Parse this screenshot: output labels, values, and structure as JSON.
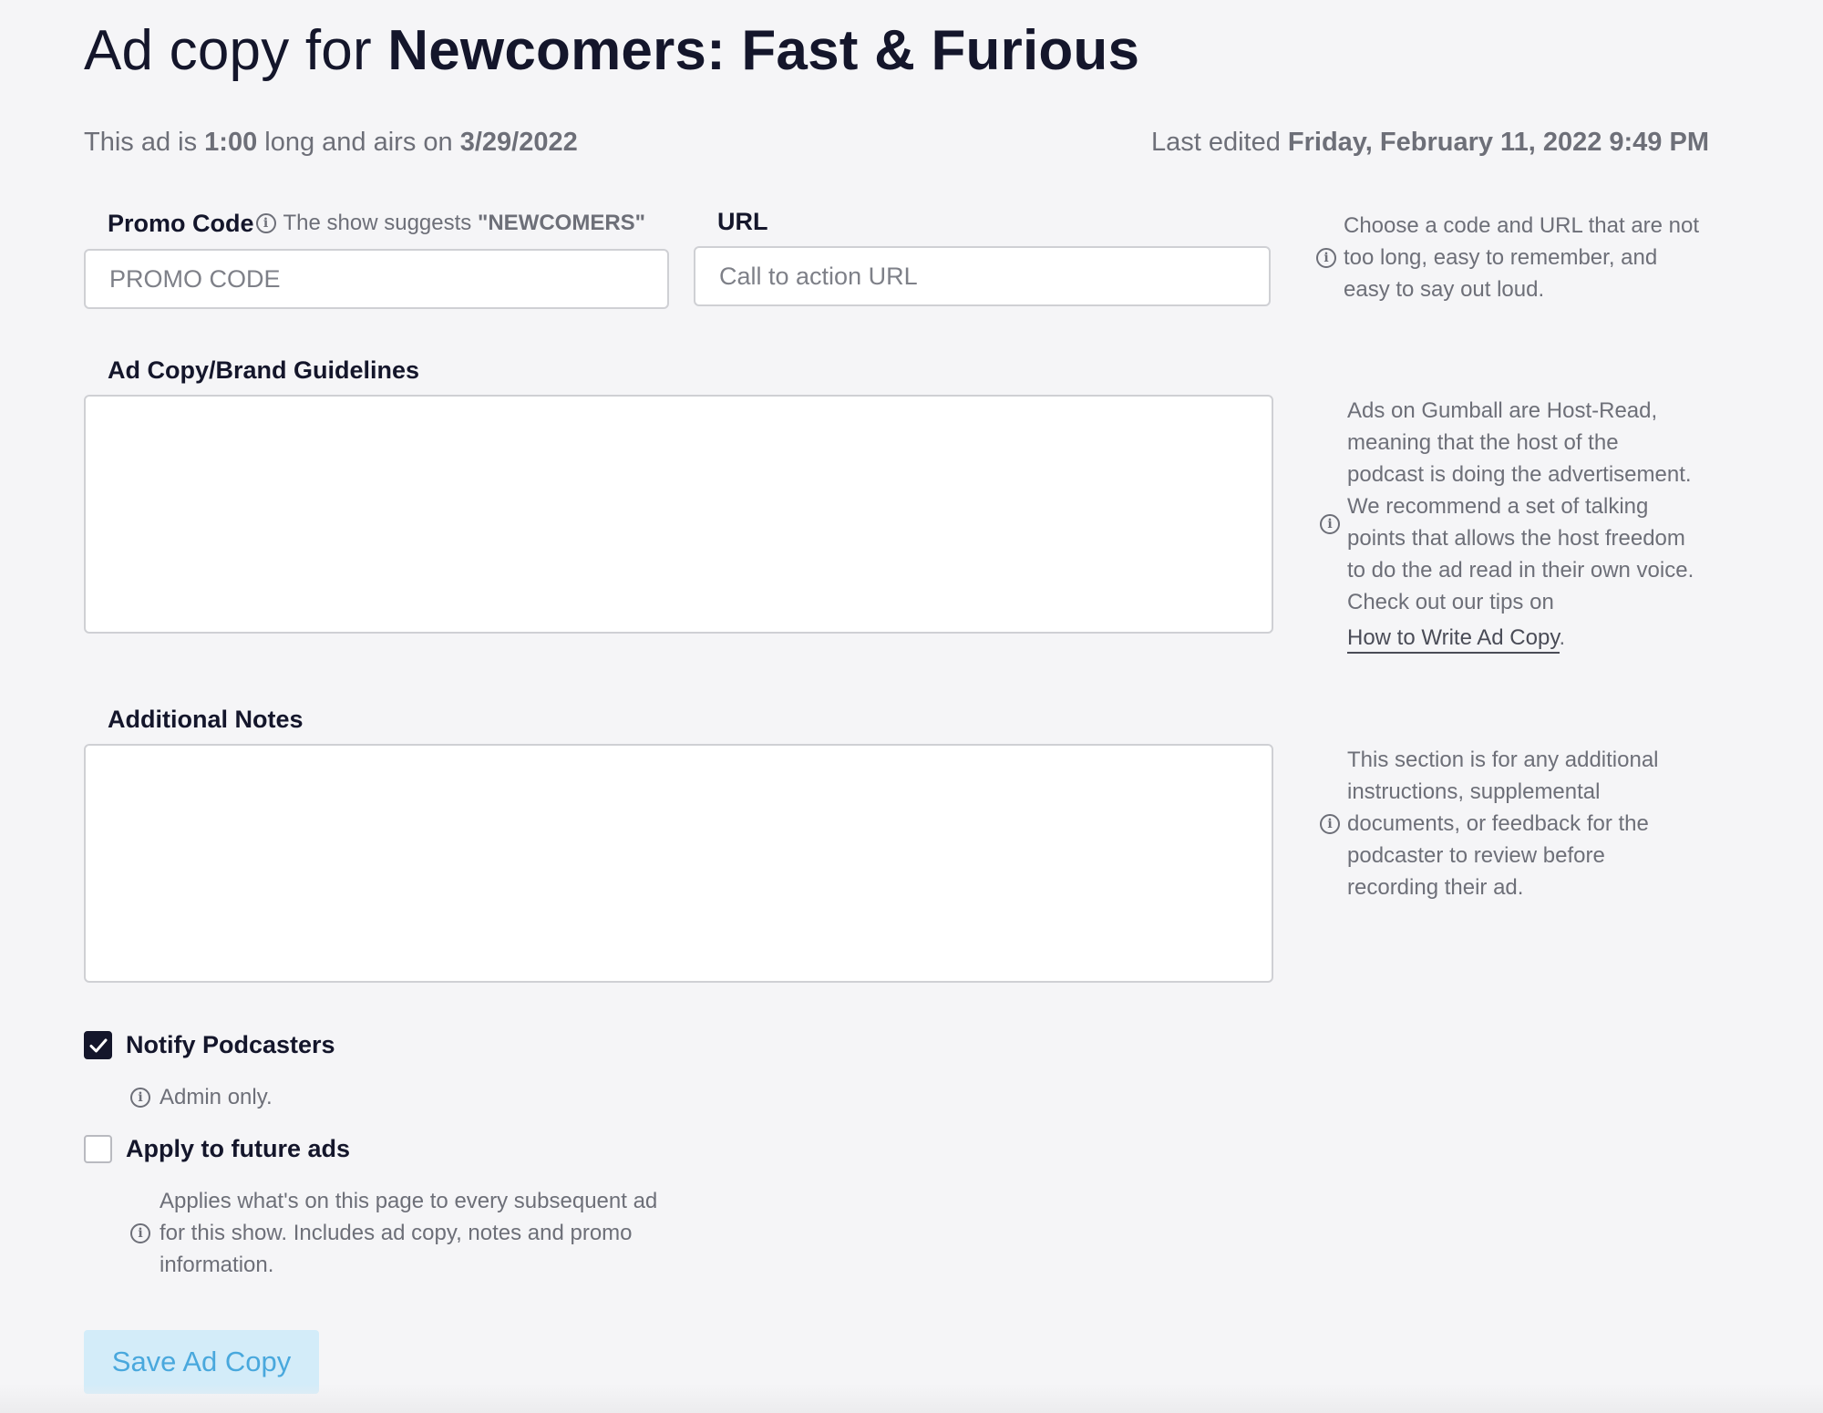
{
  "header": {
    "title_prefix": "Ad copy for ",
    "title_show": "Newcomers: Fast & Furious"
  },
  "meta": {
    "length_prefix": "This ad is ",
    "length": "1:00",
    "airs_mid": " long and airs on ",
    "air_date": "3/29/2022",
    "edited_prefix": "Last edited ",
    "edited_at": "Friday, February 11, 2022 9:49 PM"
  },
  "promo": {
    "label": "Promo Code",
    "suggest_prefix": "The show suggests ",
    "suggested_code": "\"NEWCOMERS\"",
    "placeholder": "PROMO CODE",
    "value": ""
  },
  "url": {
    "label": "URL",
    "placeholder": "Call to action URL",
    "value": ""
  },
  "guidelines": {
    "label": "Ad Copy/Brand Guidelines",
    "value": ""
  },
  "notes": {
    "label": "Additional Notes",
    "value": ""
  },
  "help": {
    "promo_lines": [
      "Choose a code and URL that are not",
      "too long, easy to remember, and",
      "easy to say out loud."
    ],
    "guidelines_lines": [
      "Ads on Gumball are Host-Read,",
      "meaning that the host of the",
      "podcast is doing the advertisement.",
      "We recommend a set of talking",
      "points that allows the host freedom",
      "to do the ad read in their own voice.",
      "Check out our tips on"
    ],
    "guidelines_link": "How to Write Ad Copy",
    "guidelines_link_suffix": ".",
    "notes_lines": [
      "This section is for any additional",
      "instructions, supplemental",
      "documents, or feedback for the",
      "podcaster to review before",
      "recording their ad."
    ]
  },
  "options": {
    "notify_label": "Notify Podcasters",
    "notify_checked": true,
    "notify_help": "Admin only.",
    "future_label": "Apply to future ads",
    "future_checked": false,
    "future_help_lines": [
      "Applies what's on this page to every subsequent ad",
      "for this show. Includes ad copy, notes and promo",
      "information."
    ]
  },
  "actions": {
    "save_label": "Save Ad Copy"
  },
  "colors": {
    "text_primary": "#14162b",
    "text_muted": "#6d6f78",
    "button_bg": "#d3ecf9",
    "button_text": "#49a8dd",
    "checkbox_checked": "#14162b"
  },
  "icons": {
    "info": "info-circle-icon",
    "check": "checkmark-icon"
  }
}
